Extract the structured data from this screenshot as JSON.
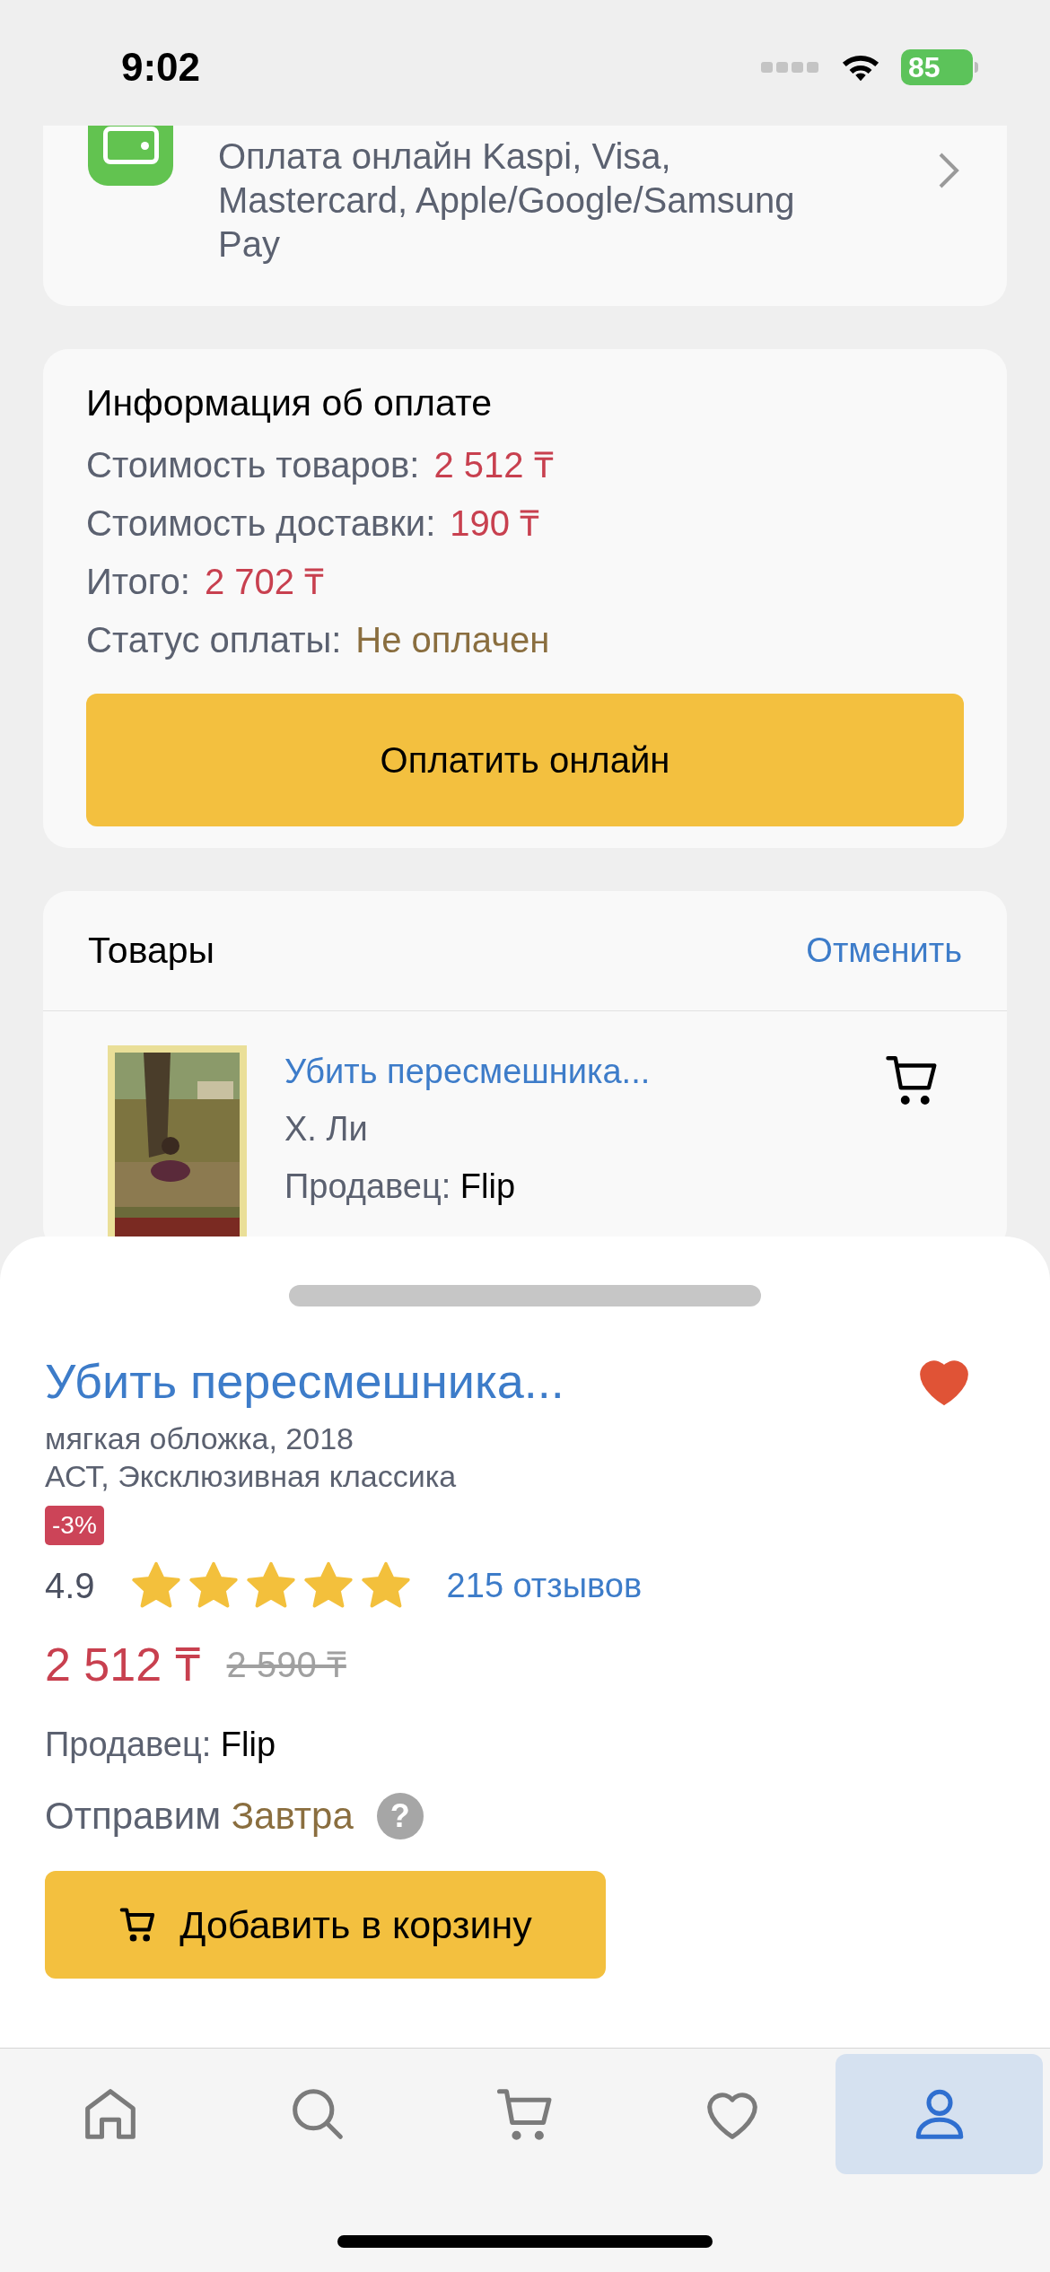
{
  "status_bar": {
    "time": "9:02",
    "battery": "85"
  },
  "payment_method": {
    "text": "Оплата онлайн Kaspi, Visa, Mastercard, Apple/Google/Samsung Pay"
  },
  "payment_info": {
    "title": "Информация об оплате",
    "rows": [
      {
        "label": "Стоимость товаров:",
        "value": "2 512 ₸",
        "kind": "price"
      },
      {
        "label": "Стоимость доставки:",
        "value": "190 ₸",
        "kind": "price"
      },
      {
        "label": "Итого:",
        "value": "2 702 ₸",
        "kind": "price"
      },
      {
        "label": "Статус оплаты:",
        "value": "Не оплачен",
        "kind": "status"
      }
    ],
    "button": "Оплатить онлайн"
  },
  "goods": {
    "title": "Товары",
    "cancel": "Отменить",
    "items": [
      {
        "title": "Убить пересмешника...",
        "author": "Х. Ли",
        "seller_label": "Продавец:",
        "seller": "Flip"
      }
    ]
  },
  "sheet": {
    "title": "Убить пересмешника...",
    "favorite": true,
    "details": [
      "мягкая обложка, 2018",
      "АСТ, Эксклюзивная классика"
    ],
    "discount": "-3%",
    "rating": "4.9",
    "stars": 5,
    "reviews": "215 отзывов",
    "price": "2 512 ₸",
    "old_price": "2 590 ₸",
    "seller_label": "Продавец:",
    "seller": "Flip",
    "ship_label": "Отправим",
    "ship_value": "Завтра",
    "help": "?",
    "button": "Добавить в корзину"
  },
  "tab_bar": [
    {
      "kind": "home",
      "selected": false
    },
    {
      "kind": "search",
      "selected": false
    },
    {
      "kind": "cart",
      "selected": false
    },
    {
      "kind": "favorites",
      "selected": false
    },
    {
      "kind": "profile",
      "selected": true
    }
  ]
}
